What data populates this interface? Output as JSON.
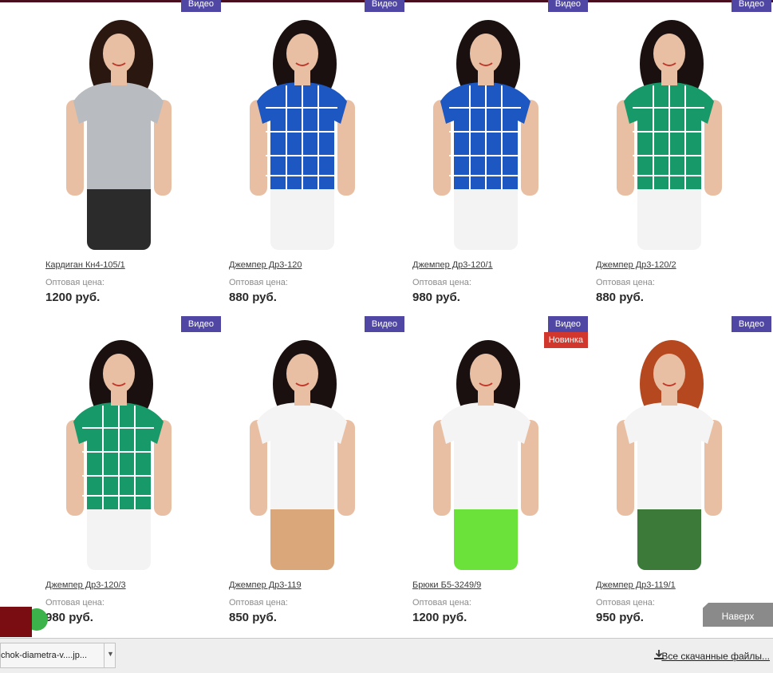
{
  "products": [
    {
      "name": "Кардиган Кн4-105/1",
      "price_label": "Оптовая цена:",
      "price": "1200 руб.",
      "badge": "Видео",
      "new_label": "",
      "top_color": "#b8bcc0",
      "bottom_color": "#2b2b2b",
      "hair_color": "#2a1810",
      "pattern": "plain"
    },
    {
      "name": "Джемпер Др3-120",
      "price_label": "Оптовая цена:",
      "price": "880 руб.",
      "badge": "Видео",
      "new_label": "",
      "top_color": "#1c57c2",
      "bottom_color": "#f3f3f3",
      "hair_color": "#1a1010",
      "pattern": "check"
    },
    {
      "name": "Джемпер Др3-120/1",
      "price_label": "Оптовая цена:",
      "price": "980 руб.",
      "badge": "Видео",
      "new_label": "",
      "top_color": "#1c57c2",
      "bottom_color": "#f3f3f3",
      "hair_color": "#1a1010",
      "pattern": "check"
    },
    {
      "name": "Джемпер Др3-120/2",
      "price_label": "Оптовая цена:",
      "price": "880 руб.",
      "badge": "Видео",
      "new_label": "",
      "top_color": "#18996a",
      "bottom_color": "#f3f3f3",
      "hair_color": "#1a1010",
      "pattern": "check"
    },
    {
      "name": "Джемпер Др3-120/3",
      "price_label": "Оптовая цена:",
      "price": "980 руб.",
      "badge": "Видео",
      "new_label": "",
      "top_color": "#18996a",
      "bottom_color": "#f3f3f3",
      "hair_color": "#1a1010",
      "pattern": "check"
    },
    {
      "name": "Джемпер Др3-119",
      "price_label": "Оптовая цена:",
      "price": "850 руб.",
      "badge": "Видео",
      "new_label": "",
      "top_color": "#f4f4f4",
      "bottom_color": "#d9a77a",
      "hair_color": "#1a1010",
      "pattern": "plain"
    },
    {
      "name": "Брюки Б5-3249/9",
      "price_label": "Оптовая цена:",
      "price": "1200 руб.",
      "badge": "Видео",
      "new_label": "Новинка",
      "top_color": "#f4f4f4",
      "bottom_color": "#6be23a",
      "hair_color": "#1a1010",
      "pattern": "plain"
    },
    {
      "name": "Джемпер Др3-119/1",
      "price_label": "Оптовая цена:",
      "price": "950 руб.",
      "badge": "Видео",
      "new_label": "",
      "top_color": "#f4f4f4",
      "bottom_color": "#3c7a3a",
      "hair_color": "#b5481f",
      "pattern": "plain"
    }
  ],
  "back_to_top": "Наверх",
  "downloads": {
    "file_label": "chok-diametra-v....jp...",
    "all_label": "Все скачанные файлы..."
  },
  "colors": {
    "video_badge": "#5047a4",
    "new_badge": "#d1372c",
    "accent_dark": "#7a0d12"
  }
}
